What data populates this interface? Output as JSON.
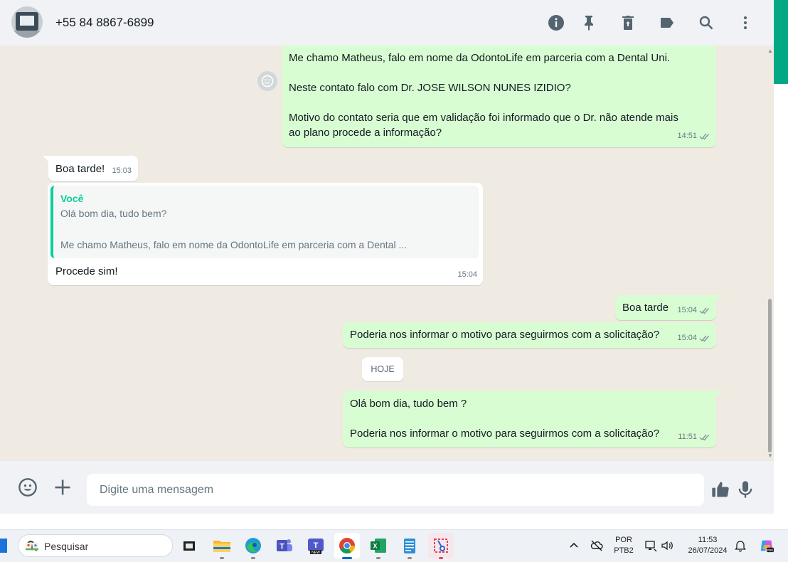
{
  "header": {
    "contact_name": "+55 84 8867-6899",
    "icons": [
      "info-icon",
      "pin-icon",
      "delete-icon",
      "label-icon",
      "search-icon",
      "menu-icon"
    ]
  },
  "messages": [
    {
      "direction": "out",
      "text": "Me chamo Matheus, falo em nome da OdontoLife em parceria com a Dental Uni.\n\nNeste contato falo com Dr. JOSE WILSON NUNES IZIDIO?\n\nMotivo do contato seria que em validação foi informado que o Dr. não atende mais\nao plano procede a informação?",
      "time": "14:51"
    },
    {
      "direction": "in",
      "text": "Boa tarde!",
      "time": "15:03"
    },
    {
      "direction": "in",
      "quoted_author": "Você",
      "quoted_text": "Olá bom dia, tudo bem?\n\nMe chamo Matheus, falo em nome da OdontoLife em parceria com a Dental ...",
      "text": "Procede sim!",
      "time": "15:04"
    },
    {
      "direction": "out",
      "text": "Boa tarde",
      "time": "15:04"
    },
    {
      "direction": "out",
      "text": "Poderia nos informar o motivo para seguirmos com a solicitação?",
      "time": "15:04"
    },
    {
      "direction": "out",
      "text": "Olá bom dia, tudo bem ?\n\nPoderia nos informar o motivo para seguirmos com a solicitação?",
      "time": "11:51"
    }
  ],
  "date_divider": "HOJE",
  "composer": {
    "placeholder": "Digite uma mensagem",
    "icons": [
      "emoji-icon",
      "attach-plus-icon",
      "thumbs-up-icon",
      "microphone-icon"
    ]
  },
  "taskbar": {
    "search_label": "Pesquisar",
    "apps": [
      "task-view",
      "file-explorer",
      "edge",
      "teams",
      "teams-new",
      "chrome",
      "excel",
      "notepad",
      "snipping-tool"
    ],
    "language_line1": "POR",
    "language_line2": "PTB2",
    "clock_time": "11:53",
    "clock_date": "26/07/2024"
  },
  "colors": {
    "outgoing_bubble": "#d9fdd3",
    "incoming_bubble": "#ffffff",
    "accent_green": "#00a884",
    "quote_author": "#06cf9c",
    "chat_background": "#efeae2"
  }
}
